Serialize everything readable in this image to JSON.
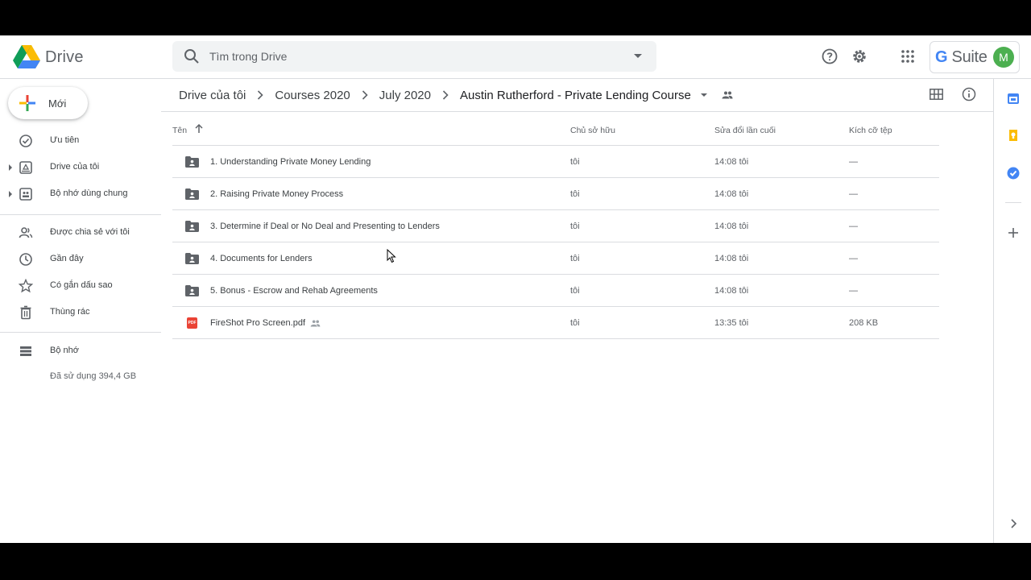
{
  "app": {
    "name": "Drive"
  },
  "header": {
    "search_placeholder": "Tìm trong Drive",
    "gsuite_label": "Suite",
    "gsuite_g": "G",
    "avatar_initial": "M"
  },
  "sidebar": {
    "new_label": "Mới",
    "items": [
      {
        "label": "Ưu tiên",
        "icon": "priority-icon"
      },
      {
        "label": "Drive của tôi",
        "icon": "my-drive-icon"
      },
      {
        "label": "Bộ nhớ dùng chung",
        "icon": "shared-drives-icon"
      },
      {
        "label": "Được chia sẻ với tôi",
        "icon": "shared-with-me-icon"
      },
      {
        "label": "Gần đây",
        "icon": "recent-icon"
      },
      {
        "label": "Có gắn dấu sao",
        "icon": "starred-icon"
      },
      {
        "label": "Thùng rác",
        "icon": "trash-icon"
      },
      {
        "label": "Bộ nhớ",
        "icon": "storage-icon"
      }
    ],
    "storage_used": "Đã sử dụng 394,4 GB"
  },
  "breadcrumb": [
    "Drive của tôi",
    "Courses 2020",
    "July 2020",
    "Austin Rutherford - Private Lending Course"
  ],
  "table": {
    "columns": [
      "Tên",
      "Chủ sở hữu",
      "Sửa đổi lần cuối",
      "Kích cỡ tệp"
    ],
    "rows": [
      {
        "name": "1. Understanding Private Money Lending",
        "type": "folder",
        "owner": "tôi",
        "modified": "14:08  tôi",
        "size": "—"
      },
      {
        "name": "2. Raising Private Money Process",
        "type": "folder",
        "owner": "tôi",
        "modified": "14:08  tôi",
        "size": "—"
      },
      {
        "name": "3. Determine if Deal or No Deal and Presenting to Lenders",
        "type": "folder",
        "owner": "tôi",
        "modified": "14:08  tôi",
        "size": "—"
      },
      {
        "name": "4. Documents for Lenders",
        "type": "folder",
        "owner": "tôi",
        "modified": "14:08  tôi",
        "size": "—"
      },
      {
        "name": "5. Bonus - Escrow and Rehab Agreements",
        "type": "folder",
        "owner": "tôi",
        "modified": "14:08  tôi",
        "size": "—"
      },
      {
        "name": "FireShot Pro Screen.pdf",
        "type": "pdf",
        "owner": "tôi",
        "modified": "13:35  tôi",
        "size": "208 KB"
      }
    ],
    "pdf_badge": "PDF"
  },
  "colors": {
    "accent": "#1a73e8",
    "divider": "#dadce0",
    "pdf_red": "#ea4335",
    "avatar_green": "#4caf50"
  }
}
